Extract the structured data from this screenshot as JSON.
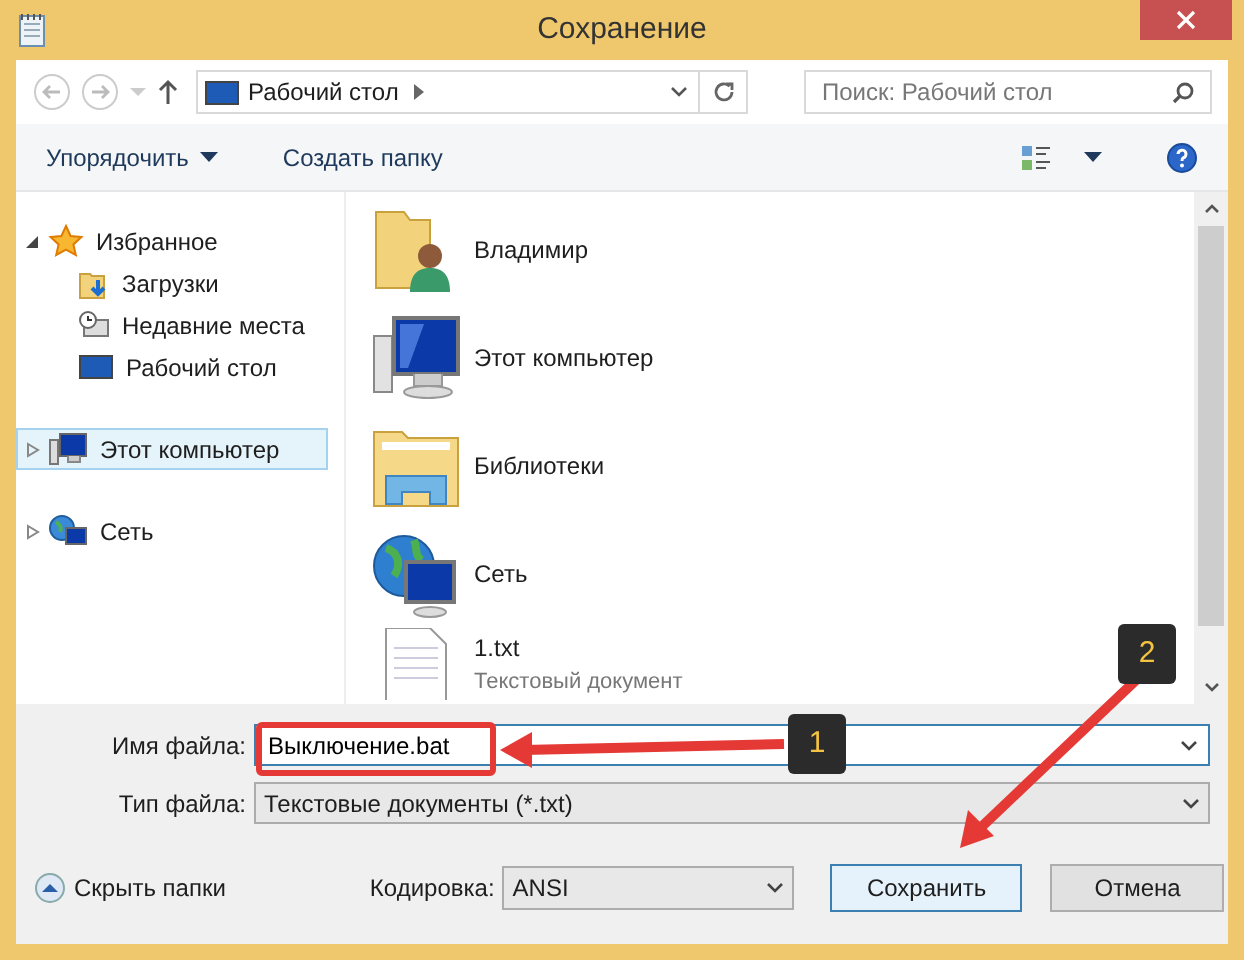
{
  "window": {
    "title": "Сохранение"
  },
  "address": {
    "path": "Рабочий стол",
    "search_placeholder": "Поиск: Рабочий стол"
  },
  "toolbar": {
    "organize": "Упорядочить",
    "new_folder": "Создать папку"
  },
  "sidebar": {
    "items": [
      {
        "label": "Избранное",
        "kind": "star",
        "selected": false,
        "expanded": true,
        "children": [
          {
            "label": "Загрузки",
            "kind": "downloads",
            "selected": false
          },
          {
            "label": "Недавние места",
            "kind": "recent",
            "selected": false
          },
          {
            "label": "Рабочий стол",
            "kind": "desktop",
            "selected": false
          }
        ]
      },
      {
        "label": "Этот компьютер",
        "kind": "computer",
        "selected": true,
        "expanded": false
      },
      {
        "label": "Сеть",
        "kind": "network",
        "selected": false,
        "expanded": false
      }
    ]
  },
  "files": [
    {
      "name": "Владимир",
      "kind": "user"
    },
    {
      "name": "Этот компьютер",
      "kind": "computer"
    },
    {
      "name": "Библиотеки",
      "kind": "library"
    },
    {
      "name": "Сеть",
      "kind": "network"
    },
    {
      "name": "1.txt",
      "kind": "text",
      "detail": "Текстовый документ"
    }
  ],
  "form": {
    "filename_label": "Имя файла:",
    "filename": "Выключение.bat",
    "type_label": "Тип файла:",
    "type": "Текстовые документы (*.txt)",
    "encoding_label": "Кодировка:",
    "encoding": "ANSI",
    "hide_folders": "Скрыть папки",
    "save": "Сохранить",
    "cancel": "Отмена"
  },
  "annotations": [
    {
      "label": "1"
    },
    {
      "label": "2"
    }
  ]
}
